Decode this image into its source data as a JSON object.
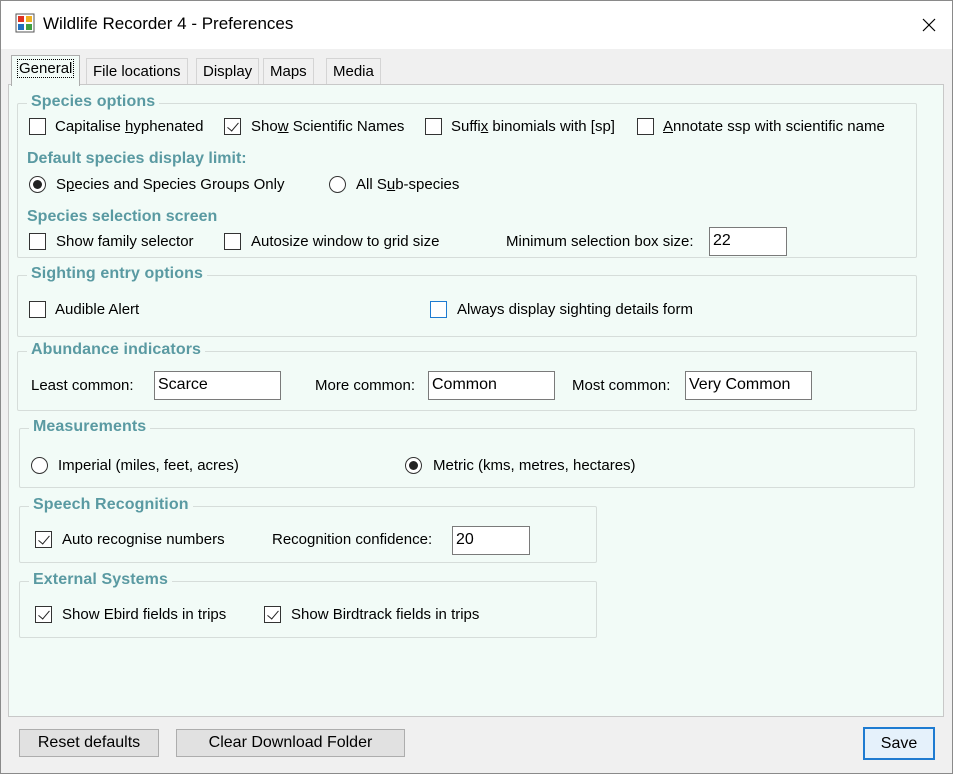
{
  "window": {
    "title": "Wildlife Recorder 4 - Preferences"
  },
  "tabs": [
    {
      "label": "General"
    },
    {
      "label": "File locations"
    },
    {
      "label": "Display"
    },
    {
      "label": "Maps"
    },
    {
      "label": "Media"
    }
  ],
  "species_options": {
    "title": "Species options",
    "capitalise_hyphenated": {
      "label_pre": "Capitalise ",
      "label_u": "h",
      "label_post": "yphenated",
      "checked": false
    },
    "show_scientific_names": {
      "label_pre": "Sho",
      "label_u": "w",
      "label_post": " Scientific Names",
      "checked": true
    },
    "suffix_binomials": {
      "label_pre": "Suffi",
      "label_u": "x",
      "label_post": " binomials with [sp]",
      "checked": false
    },
    "annotate_ssp": {
      "label_pre": "",
      "label_u": "A",
      "label_post": "nnotate ssp with scientific name",
      "checked": false
    },
    "display_limit_title": "Default species display limit:",
    "species_groups_only": {
      "label_pre": "S",
      "label_u": "p",
      "label_post": "ecies and Species Groups Only",
      "selected": true
    },
    "all_subspecies": {
      "label_pre": "All S",
      "label_u": "u",
      "label_post": "b-species",
      "selected": false
    },
    "selection_screen_title": "Species selection screen",
    "show_family_selector": {
      "label": "Show family selector",
      "checked": false
    },
    "autosize_window": {
      "label": "Autosize window to grid size",
      "checked": false
    },
    "min_box_size_label": "Minimum selection box size:",
    "min_box_size_value": "22"
  },
  "sighting_entry": {
    "title": "Sighting entry options",
    "audible_alert": {
      "label": "Audible Alert",
      "checked": false
    },
    "always_display_details": {
      "label": "Always display sighting details form",
      "checked": false
    }
  },
  "abundance": {
    "title": "Abundance indicators",
    "least_label": "Least common:",
    "least_value": "Scarce",
    "more_label": "More common:",
    "more_value": "Common",
    "most_label": "Most common:",
    "most_value": "Very Common"
  },
  "measurements": {
    "title": "Measurements",
    "imperial": {
      "label": "Imperial (miles, feet, acres)",
      "selected": false
    },
    "metric": {
      "label": "Metric (kms, metres, hectares)",
      "selected": true
    }
  },
  "speech": {
    "title": "Speech Recognition",
    "auto_recognise": {
      "label": "Auto recognise numbers",
      "checked": true
    },
    "confidence_label": "Recognition confidence:",
    "confidence_value": "20"
  },
  "external": {
    "title": "External Systems",
    "ebird": {
      "label": "Show Ebird fields in trips",
      "checked": true
    },
    "birdtrack": {
      "label": "Show Birdtrack fields in trips",
      "checked": true
    }
  },
  "buttons": {
    "reset_defaults": "Reset defaults",
    "clear_download": "Clear Download Folder",
    "save": "Save"
  },
  "colors": {
    "panel_bg": "#f2fbf7",
    "group_title": "#5a9aa2",
    "focus_blue": "#1e7bd1"
  }
}
